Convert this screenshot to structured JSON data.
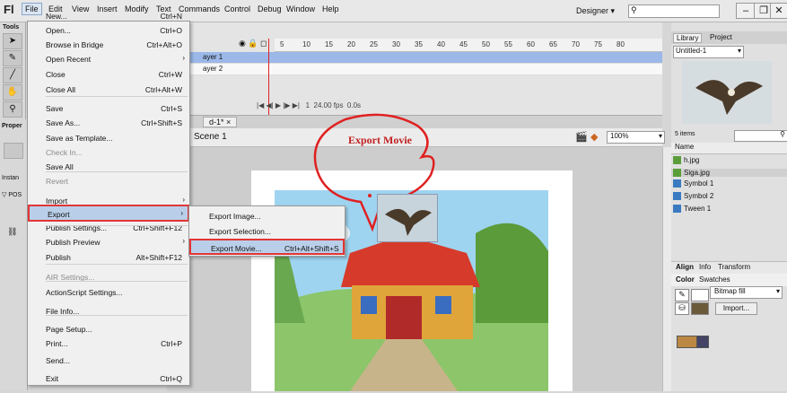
{
  "app": {
    "logo": "Fl"
  },
  "menubar": [
    "File",
    "Edit",
    "View",
    "Insert",
    "Modify",
    "Text",
    "Commands",
    "Control",
    "Debug",
    "Window",
    "Help"
  ],
  "workspace": "Designer",
  "window_buttons": [
    "–",
    "❐",
    "✕"
  ],
  "file_menu": [
    {
      "label": "New...",
      "shortcut": "Ctrl+N"
    },
    {
      "label": "Open...",
      "shortcut": "Ctrl+O"
    },
    {
      "label": "Browse in Bridge",
      "shortcut": "Ctrl+Alt+O"
    },
    {
      "label": "Open Recent",
      "shortcut": "",
      "submenu": true
    },
    {
      "label": "Close",
      "shortcut": "Ctrl+W"
    },
    {
      "label": "Close All",
      "shortcut": "Ctrl+Alt+W"
    },
    {
      "label": "Save",
      "shortcut": "Ctrl+S"
    },
    {
      "label": "Save As...",
      "shortcut": "Ctrl+Shift+S"
    },
    {
      "label": "Save as Template...",
      "shortcut": ""
    },
    {
      "label": "Check In...",
      "shortcut": "",
      "disabled": true
    },
    {
      "label": "Save All",
      "shortcut": ""
    },
    {
      "label": "Revert",
      "shortcut": "",
      "disabled": true
    },
    {
      "label": "Import",
      "shortcut": "",
      "submenu": true
    },
    {
      "label": "Export",
      "shortcut": "",
      "submenu": true,
      "selected": true
    },
    {
      "label": "Publish Settings...",
      "shortcut": "Ctrl+Shift+F12"
    },
    {
      "label": "Publish Preview",
      "shortcut": "",
      "submenu": true
    },
    {
      "label": "Publish",
      "shortcut": "Alt+Shift+F12"
    },
    {
      "label": "AIR Settings...",
      "shortcut": "",
      "disabled": true
    },
    {
      "label": "ActionScript Settings...",
      "shortcut": ""
    },
    {
      "label": "File Info...",
      "shortcut": ""
    },
    {
      "label": "Page Setup...",
      "shortcut": ""
    },
    {
      "label": "Print...",
      "shortcut": "Ctrl+P"
    },
    {
      "label": "Send...",
      "shortcut": ""
    },
    {
      "label": "Exit",
      "shortcut": "Ctrl+Q"
    }
  ],
  "export_submenu": [
    {
      "label": "Export Image...",
      "shortcut": ""
    },
    {
      "label": "Export Selection...",
      "shortcut": ""
    },
    {
      "label": "Export Movie...",
      "shortcut": "Ctrl+Alt+Shift+S",
      "selected": true
    }
  ],
  "annotation": "Export Movie",
  "tools": {
    "label": "Tools"
  },
  "properties": {
    "label": "Proper",
    "instance": "Instan",
    "position": "POS"
  },
  "timeline": {
    "layers": [
      "ayer 1",
      "ayer 2"
    ],
    "frames": [
      "5",
      "10",
      "15",
      "20",
      "25",
      "30",
      "35",
      "40",
      "45",
      "50",
      "55",
      "60",
      "65",
      "70",
      "75",
      "80"
    ],
    "fps": "24.00 fps",
    "time": "0.0s",
    "frame_no": "1"
  },
  "document": {
    "tab": "d-1* ×",
    "scene": "Scene 1",
    "zoom": "100%"
  },
  "library": {
    "tabs": [
      "Library",
      "Project"
    ],
    "doc": "Untitled-1",
    "count": "5 items",
    "name_col": "Name",
    "items": [
      {
        "name": "h.jpg",
        "icon": "bitmap-icon"
      },
      {
        "name": "Siga.jpg",
        "icon": "bitmap-icon"
      },
      {
        "name": "Symbol 1",
        "icon": "symbol-icon"
      },
      {
        "name": "Symbol 2",
        "icon": "symbol-icon"
      },
      {
        "name": "Tween 1",
        "icon": "graphic-icon"
      }
    ]
  },
  "align_tabs": [
    "Align",
    "Info",
    "Transform"
  ],
  "color_tabs": [
    "Color",
    "Swatches"
  ],
  "fill_type": "Bitmap fill",
  "import_btn": "Import..."
}
